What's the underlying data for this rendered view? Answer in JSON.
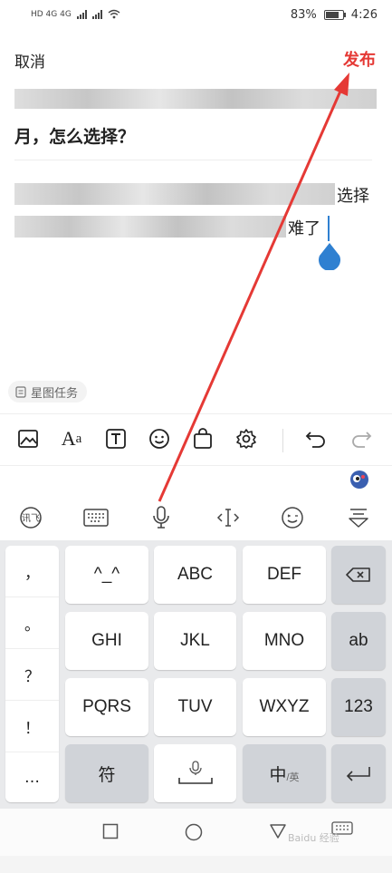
{
  "status_bar": {
    "left_indicators": "HD 4G 4G",
    "battery_percent": "83%",
    "time": "4:26"
  },
  "header": {
    "cancel_label": "取消",
    "publish_label": "发布",
    "publish_color": "#e53935"
  },
  "editor": {
    "title_visible": "月，怎么选择？",
    "body_line1_end": "选择",
    "body_line2_end": "难了",
    "cursor_color": "#2f80d1"
  },
  "tag_chip": {
    "label": "星图任务"
  },
  "toolbar": {
    "icons": [
      "image-icon",
      "text-format-icon",
      "text-box-icon",
      "emoji-icon",
      "bag-icon",
      "settings-icon",
      "undo-icon",
      "redo-icon"
    ]
  },
  "keyboard": {
    "punctuation": [
      "，",
      "。",
      "？",
      "！",
      "…"
    ],
    "row1": [
      "^_^",
      "ABC",
      "DEF"
    ],
    "row2": [
      "GHI",
      "JKL",
      "MNO"
    ],
    "row3": [
      "PQRS",
      "TUV",
      "WXYZ"
    ],
    "right_keys": {
      "abc": "ab",
      "num": "123"
    },
    "symbol_label": "符",
    "zh_label": "中",
    "zh_sub": "/英"
  },
  "watermark": "Baidu 经验"
}
